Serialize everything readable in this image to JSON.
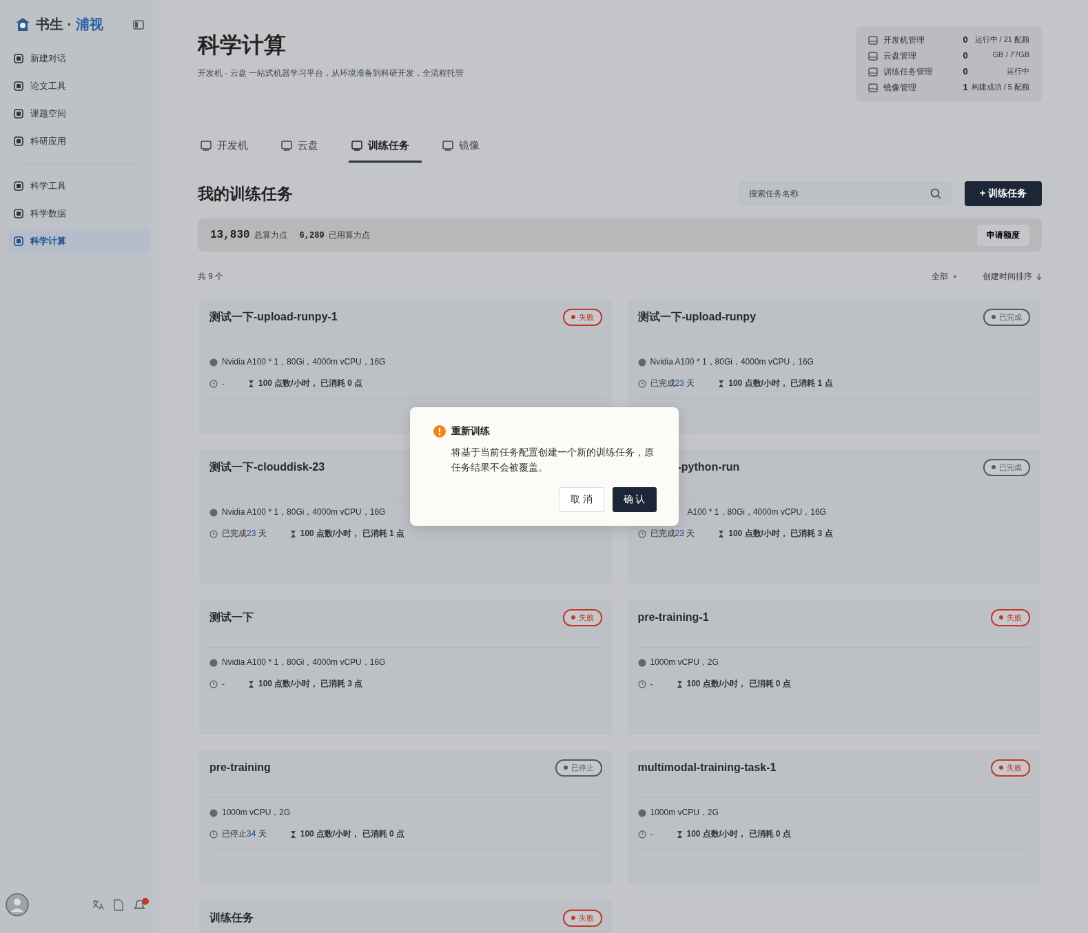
{
  "sidebar": {
    "logo": {
      "name": "书生 ·",
      "accent": "浦视"
    },
    "groups": [
      [
        {
          "label": "新建对话",
          "selected": false
        },
        {
          "label": "论文工具",
          "selected": false
        },
        {
          "label": "课题空间",
          "selected": false
        },
        {
          "label": "科研应用",
          "selected": false
        }
      ],
      [
        {
          "label": "科学工具",
          "selected": false
        },
        {
          "label": "科学数据",
          "selected": false
        },
        {
          "label": "科学计算",
          "selected": true
        }
      ]
    ]
  },
  "header": {
    "title": "科学计算",
    "subtitle": "开发机 · 云盘 一站式机器学习平台，从环境准备到科研开发，全流程托管",
    "stats": [
      {
        "label": "开发机管理",
        "value": "0",
        "note": "运行中 / 21 配额"
      },
      {
        "label": "云盘管理",
        "value": "0",
        "note": "GB / 77GB"
      },
      {
        "label": "训练任务管理",
        "value": "0",
        "note": "运行中"
      },
      {
        "label": "镜像管理",
        "value": "1",
        "note": "构建成功 / 5 配额"
      }
    ]
  },
  "tabs": [
    {
      "label": "开发机",
      "selected": false
    },
    {
      "label": "云盘",
      "selected": false
    },
    {
      "label": "训练任务",
      "selected": true
    },
    {
      "label": "镜像",
      "selected": false
    }
  ],
  "section": {
    "title": "我的训练任务",
    "search": {
      "placeholder": "搜索任务名称"
    },
    "new_button": "+ 训练任务"
  },
  "points": {
    "total": "13,830",
    "total_label": "总算力点",
    "used": "6,289",
    "used_label": "已用算力点",
    "apply_button": "申请额度"
  },
  "list_meta": {
    "count": "共 9 个",
    "filter": "全部",
    "sort": "创建时间排序"
  },
  "tasks": [
    {
      "name": "测试一下-upload-runpy-1",
      "status": "失败",
      "color": "#c0392b",
      "resource": "Nvidia A100 * 1，80Gi，4000m vCPU，16G",
      "state": "-",
      "cost": "100 点数/小时， 已消耗 0 点"
    },
    {
      "name": "测试一下-upload-runpy",
      "status": "已完成",
      "color": "#555a60",
      "resource": "Nvidia A100 * 1，80Gi，4000m vCPU，16G",
      "state": "已完成",
      "days": "23",
      "unit": "天",
      "cost": "100 点数/小时， 已消耗 1 点"
    },
    {
      "name": "测试一下-clouddisk-23",
      "resource": "Nvidia A100 * 1，80Gi，4000m vCPU，16G",
      "state": "已完成",
      "days": "23",
      "unit": "天",
      "cost": "100 点数/小时， 已消耗 1 点"
    },
    {
      "name": "-python-run",
      "status": "已完成",
      "color": "#555a60",
      "resource": "A100 * 1，80Gi，4000m vCPU，16G",
      "state": "已完成",
      "days": "23",
      "unit": "天",
      "cost": "100 点数/小时， 已消耗 3 点"
    },
    {
      "name": "测试一下",
      "status": "失败",
      "color": "#c0392b",
      "resource": "Nvidia A100 * 1，80Gi，4000m vCPU，16G",
      "state": "-",
      "cost": "100 点数/小时， 已消耗 3 点"
    },
    {
      "name": "pre-training-1",
      "status": "失败",
      "color": "#c0392b",
      "resource": "1000m vCPU，2G",
      "state": "-",
      "cost": "100 点数/小时， 已消耗 0 点"
    },
    {
      "name": "pre-training",
      "status": "已停止",
      "color": "#555a60",
      "resource": "1000m vCPU，2G",
      "state": "已停止",
      "days": "34",
      "unit": "天",
      "cost": "100 点数/小时， 已消耗 0 点"
    },
    {
      "name": "multimodal-training-task-1",
      "status": "失败",
      "color": "#c0392b",
      "resource": "1000m vCPU，2G",
      "state": "-",
      "cost": "100 点数/小时， 已消耗 0 点"
    },
    {
      "name": "训练任务",
      "status": "失败",
      "color": "#c0392b"
    }
  ],
  "dialog": {
    "title": "重新训练",
    "message": "将基于当前任务配置创建一个新的训练任务，原任务结果不会被覆盖。",
    "cancel": "取 消",
    "confirm": "确 认"
  }
}
